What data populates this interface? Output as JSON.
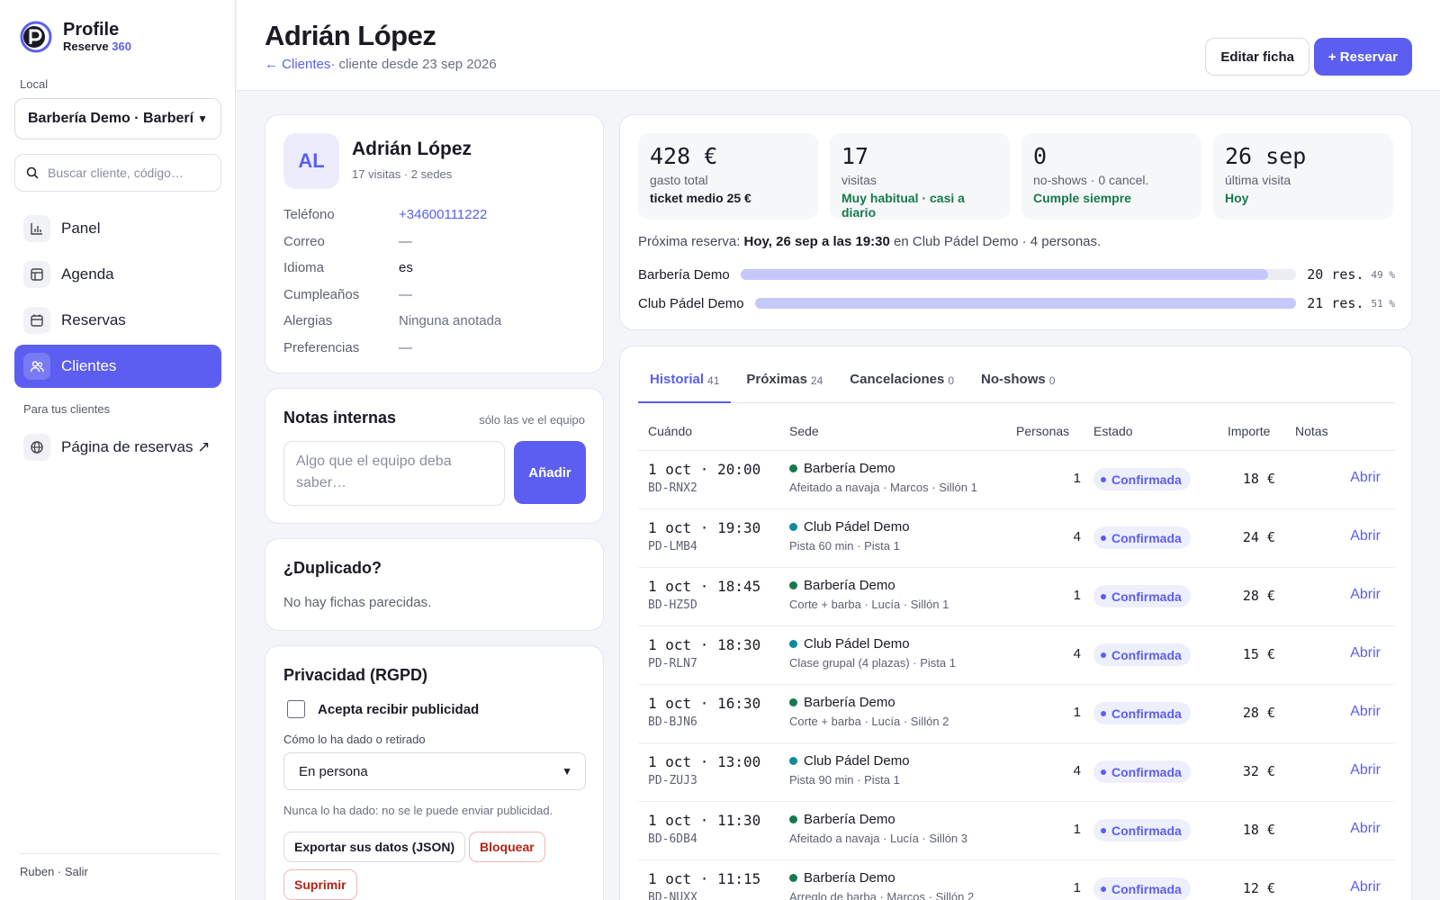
{
  "brand": {
    "name": "Profile",
    "sub_main": "Reserve",
    "sub_accent": "360",
    "accent_color": "#5b5ef0"
  },
  "sidebar": {
    "local_label": "Local",
    "local_value": "Barbería Demo · Barberí",
    "search_placeholder": "Buscar cliente, código…",
    "nav": [
      {
        "label": "Panel",
        "icon": "chart-icon"
      },
      {
        "label": "Agenda",
        "icon": "table-icon"
      },
      {
        "label": "Reservas",
        "icon": "calendar-icon"
      },
      {
        "label": "Clientes",
        "icon": "users-icon",
        "active": true
      }
    ],
    "section_label": "Para tus clientes",
    "ext_link": "Página de reservas ↗",
    "footer_user": "Ruben",
    "footer_logout": "Salir"
  },
  "header": {
    "title": "Adrián López",
    "back_link": "← Clientes",
    "since": "· cliente desde 23 sep 2026",
    "edit_button": "Editar ficha",
    "reserve_button": "+ Reservar"
  },
  "profile": {
    "initials": "AL",
    "name": "Adrián López",
    "summary": "17 visitas · 2 sedes",
    "fields": [
      {
        "label": "Teléfono",
        "value": "+34600111222",
        "type": "link"
      },
      {
        "label": "Correo",
        "value": "—",
        "type": "muted"
      },
      {
        "label": "Idioma",
        "value": "es",
        "type": "plain"
      },
      {
        "label": "Cumpleaños",
        "value": "—",
        "type": "muted"
      },
      {
        "label": "Alergias",
        "value": "Ninguna anotada",
        "type": "muted"
      },
      {
        "label": "Preferencias",
        "value": "—",
        "type": "muted"
      }
    ]
  },
  "notes": {
    "title": "Notas internas",
    "hint": "sólo las ve el equipo",
    "placeholder": "Algo que el equipo deba saber…",
    "add_button": "Añadir"
  },
  "duplicate": {
    "title": "¿Duplicado?",
    "text": "No hay fichas parecidas."
  },
  "privacy": {
    "title": "Privacidad (RGPD)",
    "consent_label": "Acepta recibir publicidad",
    "consent_checked": false,
    "how_label": "Cómo lo ha dado o retirado",
    "how_value": "En persona",
    "note": "Nunca lo ha dado: no se le puede enviar publicidad.",
    "export_button": "Exportar sus datos (JSON)",
    "block_button": "Bloquear",
    "delete_button": "Suprimir"
  },
  "stats": [
    {
      "value": "428 €",
      "label": "gasto total",
      "extra": "ticket medio 25 €",
      "extra_green": false
    },
    {
      "value": "17",
      "label": "visitas",
      "extra": "Muy habitual · casi a diario",
      "extra_green": true
    },
    {
      "value": "0",
      "label": "no-shows · 0 cancel.",
      "extra": "Cumple siempre",
      "extra_green": true
    },
    {
      "value": "26 sep",
      "label": "última visita",
      "extra": "Hoy",
      "extra_green": true
    }
  ],
  "next_reservation": {
    "prefix": "Próxima reserva: ",
    "when": "Hoy, 26 sep a las 19:30",
    "suffix": " en Club Pádel Demo · 4 personas."
  },
  "venue_split": [
    {
      "name": "Barbería Demo",
      "count": "20 res.",
      "pct": "49 %",
      "fraction": 0.95
    },
    {
      "name": "Club Pádel Demo",
      "count": "21 res.",
      "pct": "51 %",
      "fraction": 1.0
    }
  ],
  "tabs": [
    {
      "label": "Historial",
      "count": "41",
      "active": true
    },
    {
      "label": "Próximas",
      "count": "24"
    },
    {
      "label": "Cancelaciones",
      "count": "0"
    },
    {
      "label": "No-shows",
      "count": "0"
    }
  ],
  "table": {
    "headers": {
      "when": "Cuándo",
      "sede": "Sede",
      "people": "Personas",
      "status": "Estado",
      "amount": "Importe",
      "notes": "Notas"
    },
    "open_label": "Abrir",
    "rows": [
      {
        "when": "1 oct · 20:00",
        "code": "BD-RNX2",
        "sede": "Barbería Demo",
        "detail": "Afeitado a navaja · Marcos · Sillón 1",
        "people": "1",
        "status": "Confirmada",
        "amount": "18 €",
        "color": "#16794b"
      },
      {
        "when": "1 oct · 19:30",
        "code": "PD-LMB4",
        "sede": "Club Pádel Demo",
        "detail": "Pista 60 min · Pista 1",
        "people": "4",
        "status": "Confirmada",
        "amount": "24 €",
        "color": "#0e8a9a"
      },
      {
        "when": "1 oct · 18:45",
        "code": "BD-HZ5D",
        "sede": "Barbería Demo",
        "detail": "Corte + barba · Lucía · Sillón 1",
        "people": "1",
        "status": "Confirmada",
        "amount": "28 €",
        "color": "#16794b"
      },
      {
        "when": "1 oct · 18:30",
        "code": "PD-RLN7",
        "sede": "Club Pádel Demo",
        "detail": "Clase grupal (4 plazas) · Pista 1",
        "people": "4",
        "status": "Confirmada",
        "amount": "15 €",
        "color": "#0e8a9a"
      },
      {
        "when": "1 oct · 16:30",
        "code": "BD-BJN6",
        "sede": "Barbería Demo",
        "detail": "Corte + barba · Lucía · Sillón 2",
        "people": "1",
        "status": "Confirmada",
        "amount": "28 €",
        "color": "#16794b"
      },
      {
        "when": "1 oct · 13:00",
        "code": "PD-ZUJ3",
        "sede": "Club Pádel Demo",
        "detail": "Pista 90 min · Pista 1",
        "people": "4",
        "status": "Confirmada",
        "amount": "32 €",
        "color": "#0e8a9a"
      },
      {
        "when": "1 oct · 11:30",
        "code": "BD-6DB4",
        "sede": "Barbería Demo",
        "detail": "Afeitado a navaja · Lucía · Sillón 3",
        "people": "1",
        "status": "Confirmada",
        "amount": "18 €",
        "color": "#16794b"
      },
      {
        "when": "1 oct · 11:15",
        "code": "BD-NUXX",
        "sede": "Barbería Demo",
        "detail": "Arreglo de barba · Marcos · Sillón 2",
        "people": "1",
        "status": "Confirmada",
        "amount": "12 €",
        "color": "#16794b"
      }
    ]
  }
}
